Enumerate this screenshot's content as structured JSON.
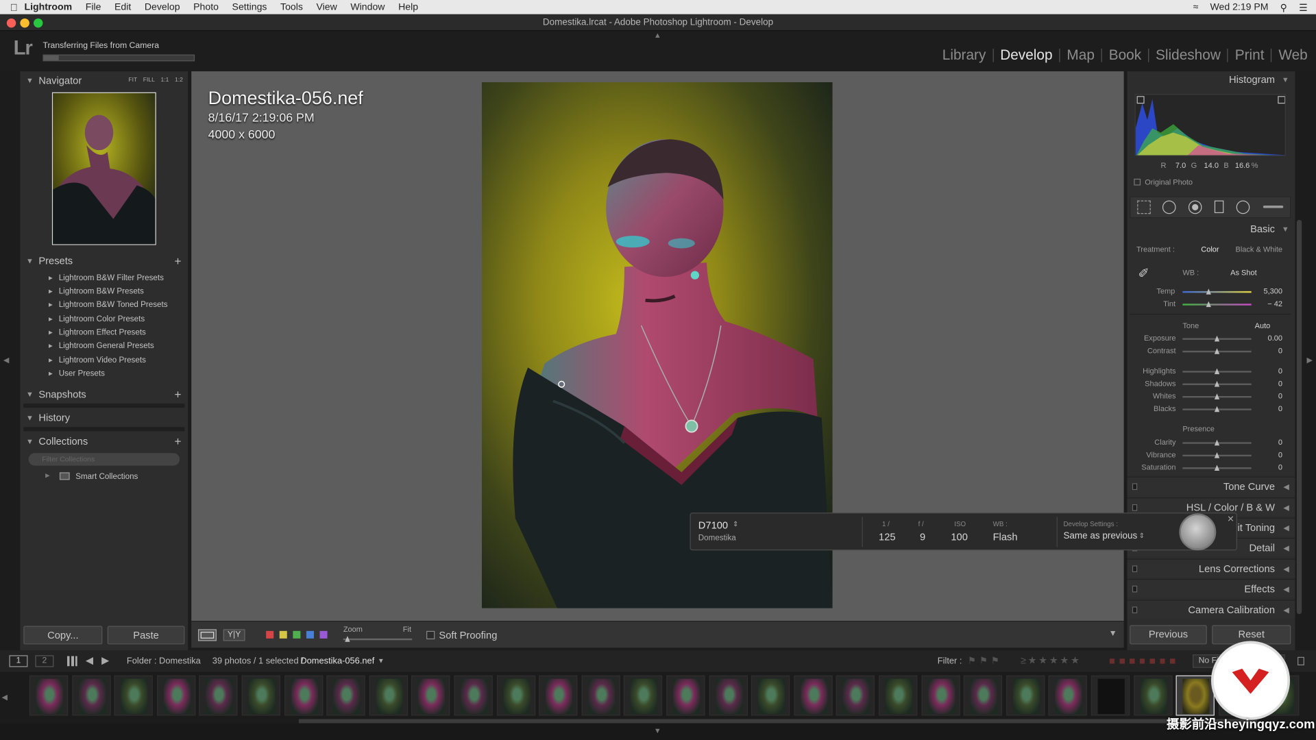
{
  "menubar": {
    "app": "Lightroom",
    "items": [
      "File",
      "Edit",
      "Develop",
      "Photo",
      "Settings",
      "Tools",
      "View",
      "Window",
      "Help"
    ],
    "clock": "Wed 2:19 PM"
  },
  "window": {
    "title": "Domestika.lrcat - Adobe Photoshop Lightroom - Develop"
  },
  "header": {
    "logo": "Lr",
    "transfer_label": "Transferring Files from Camera",
    "transfer_progress": 0.1,
    "modules": [
      "Library",
      "Develop",
      "Map",
      "Book",
      "Slideshow",
      "Print",
      "Web"
    ],
    "active_module": "Develop"
  },
  "left": {
    "navigator": {
      "title": "Navigator",
      "options": [
        "FIT",
        "FILL",
        "1:1",
        "1:2"
      ]
    },
    "presets": {
      "title": "Presets",
      "items": [
        "Lightroom B&W Filter Presets",
        "Lightroom B&W Presets",
        "Lightroom B&W Toned Presets",
        "Lightroom Color Presets",
        "Lightroom Effect Presets",
        "Lightroom General Presets",
        "Lightroom Video Presets",
        "User Presets"
      ]
    },
    "snapshots": {
      "title": "Snapshots"
    },
    "history": {
      "title": "History"
    },
    "collections": {
      "title": "Collections",
      "filter_placeholder": "Filter Collections",
      "smart": "Smart Collections"
    },
    "copy_label": "Copy...",
    "paste_label": "Paste"
  },
  "photo": {
    "name": "Domestika-056.nef",
    "date": "8/16/17 2:19:06 PM",
    "dims": "4000 x 6000"
  },
  "toolbar": {
    "zoom_label": "Zoom",
    "fit_label": "Fit",
    "soft_proofing": "Soft Proofing",
    "flag_colors": [
      "#d64545",
      "#d6c445",
      "#4fb04f",
      "#4a7fd6",
      "#9a5ad6"
    ]
  },
  "right": {
    "histogram": {
      "title": "Histogram",
      "r_label": "R",
      "r": "7.0",
      "g_label": "G",
      "g": "14.0",
      "b_label": "B",
      "b": "16.6",
      "unit": "%",
      "original": "Original Photo"
    },
    "basic": {
      "title": "Basic",
      "treatment_label": "Treatment :",
      "treatment_color": "Color",
      "treatment_bw": "Black & White",
      "wb_label": "WB :",
      "wb_value": "As Shot",
      "temp_label": "Temp",
      "temp_value": "5,300",
      "temp_pos": 0.38,
      "tint_label": "Tint",
      "tint_value": "− 42",
      "tint_pos": 0.38,
      "tone_label": "Tone",
      "auto_label": "Auto",
      "tone_sliders": [
        {
          "label": "Exposure",
          "value": "0.00"
        },
        {
          "label": "Contrast",
          "value": "0"
        },
        {
          "label": "Highlights",
          "value": "0"
        },
        {
          "label": "Shadows",
          "value": "0"
        },
        {
          "label": "Whites",
          "value": "0"
        },
        {
          "label": "Blacks",
          "value": "0"
        }
      ],
      "presence_label": "Presence",
      "presence_sliders": [
        {
          "label": "Clarity",
          "value": "0"
        },
        {
          "label": "Vibrance",
          "value": "0"
        },
        {
          "label": "Saturation",
          "value": "0"
        }
      ]
    },
    "panels": [
      "Tone Curve",
      "HSL  /  Color  /  B & W",
      "Split Toning",
      "Detail",
      "Lens Corrections",
      "Effects",
      "Camera Calibration"
    ],
    "previous_label": "Previous",
    "reset_label": "Reset"
  },
  "overlay": {
    "camera": "D7100",
    "name": "Domestika",
    "shutter_label": "1 /",
    "shutter": "125",
    "aperture_label": "f /",
    "aperture": "9",
    "iso_label": "ISO",
    "iso": "100",
    "wb_label": "WB :",
    "wb": "Flash",
    "dev_label": "Develop Settings :",
    "dev_value": "Same as previous"
  },
  "filmstrip": {
    "folder": "Folder : Domestika",
    "count": "39 photos / 1 selected /",
    "file": "Domestika-056.nef",
    "filter_label": "Filter :",
    "no_filter": "No Filter",
    "page1": "1",
    "page2": "2"
  },
  "watermark": "摄影前沿sheyingqyz.com"
}
